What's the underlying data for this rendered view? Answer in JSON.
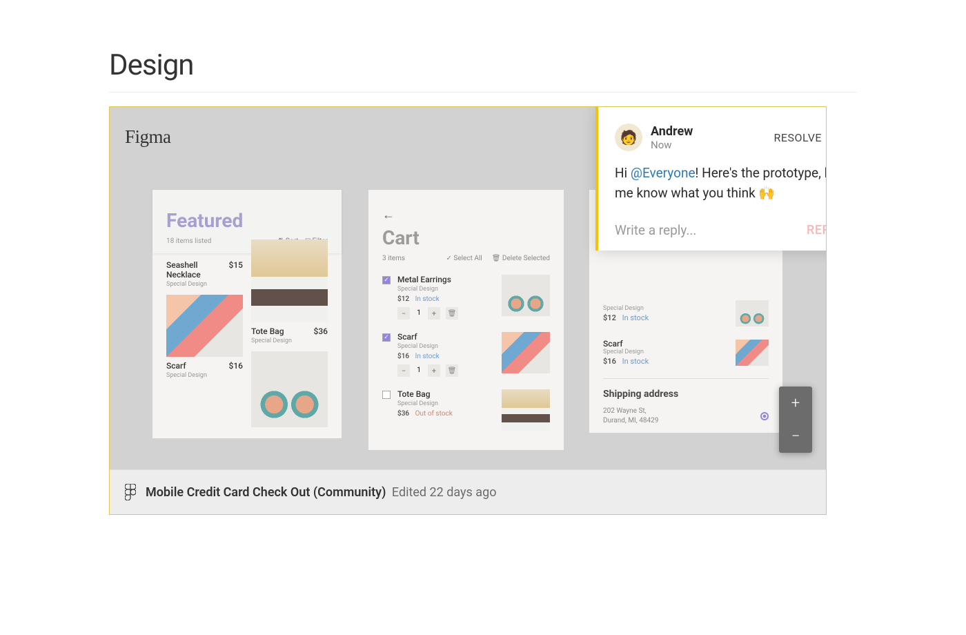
{
  "page": {
    "title": "Design"
  },
  "embed": {
    "app_label": "Figma",
    "file_name": "Mobile Credit Card Check Out (Community)",
    "edited_label": "Edited 22 days ago"
  },
  "featured": {
    "title": "Featured",
    "count_label": "18 items listed",
    "sort_label": "Sort",
    "filter_label": "Filter",
    "products": [
      {
        "name": "Seashell Necklace",
        "price": "$15",
        "sub": "Special Design"
      },
      {
        "name": "Tote Bag",
        "price": "$36",
        "sub": "Special Design"
      },
      {
        "name": "Scarf",
        "price": "$16",
        "sub": "Special Design"
      },
      {
        "name": "",
        "price": "",
        "sub": ""
      }
    ]
  },
  "cart": {
    "title": "Cart",
    "count_label": "3 items",
    "select_all": "Select All",
    "delete_selected": "Delete Selected",
    "items": [
      {
        "name": "Metal Earrings",
        "sub": "Special Design",
        "price": "$12",
        "stock": "In stock",
        "qty": "1",
        "checked": true
      },
      {
        "name": "Scarf",
        "sub": "Special Design",
        "price": "$16",
        "stock": "In stock",
        "qty": "1",
        "checked": true
      },
      {
        "name": "Tote Bag",
        "sub": "Special Design",
        "price": "$36",
        "stock": "Out of stock",
        "qty": "1",
        "checked": false
      }
    ]
  },
  "summary": {
    "minis": [
      {
        "sub": "Special Design",
        "price": "$12",
        "stock": "In stock"
      },
      {
        "sub_top": "Scarf",
        "sub": "Special Design",
        "price": "$16",
        "stock": "In stock"
      }
    ],
    "ship_title": "Shipping address",
    "address_line1": "202 Wayne St,",
    "address_line2": "Durand, MI, 48429"
  },
  "comment": {
    "author": "Andrew",
    "time": "Now",
    "resolve": "RESOLVE",
    "body_prefix": "Hi ",
    "mention": "@Everyone",
    "body_suffix": "! Here's the prototype, let me know what you think 🙌",
    "reply_placeholder": "Write a reply...",
    "reply_button": "REPLY"
  },
  "zoom": {
    "in_label": "+",
    "out_label": "−"
  }
}
